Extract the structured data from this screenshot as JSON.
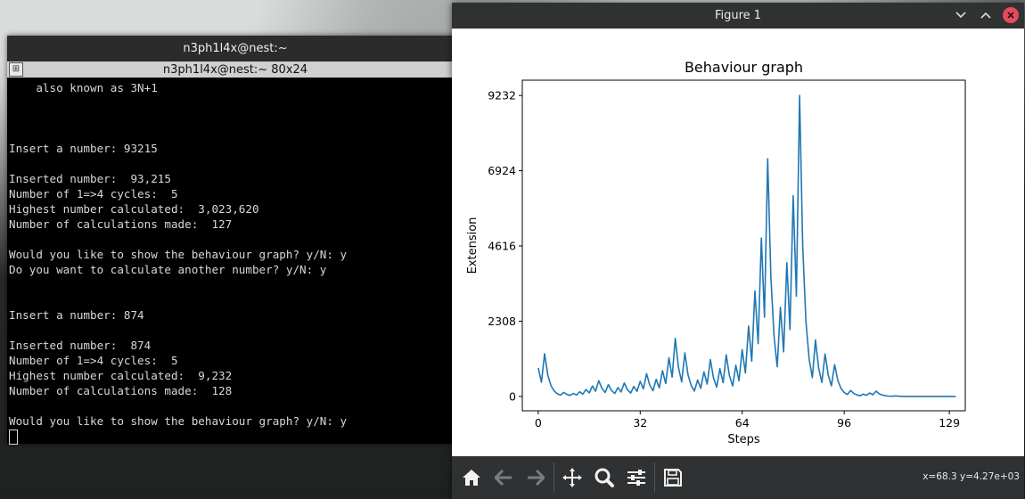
{
  "terminal": {
    "title": "n3ph1l4x@nest:~",
    "tab_title": "n3ph1l4x@nest:~ 80x24",
    "lines": [
      "    also known as 3N+1",
      "",
      "",
      "",
      "Insert a number: 93215",
      "",
      "Inserted number:  93,215",
      "Number of 1=>4 cycles:  5",
      "Highest number calculated:  3,023,620",
      "Number of calculations made:  127",
      "",
      "Would you like to show the behaviour graph? y/N: y",
      "Do you want to calculate another number? y/N: y",
      "",
      "",
      "Insert a number: 874",
      "",
      "Inserted number:  874",
      "Number of 1=>4 cycles:  5",
      "Highest number calculated:  9,232",
      "Number of calculations made:  128",
      "",
      "Would you like to show the behaviour graph? y/N: y"
    ]
  },
  "figure": {
    "title": "Figure 1",
    "coords": "x=68.3 y=4.27e+03",
    "toolbar": [
      "home-icon",
      "back-icon",
      "forward-icon",
      "pan-icon",
      "zoom-icon",
      "configure-icon",
      "save-icon"
    ],
    "colors": {
      "line": "#1f77b4",
      "window_bar": "#2f3133",
      "close_button": "#e64b5b"
    }
  },
  "chart_data": {
    "type": "line",
    "title": "Behaviour graph",
    "xlabel": "Steps",
    "ylabel": "Extension",
    "xlim": [
      -5,
      134
    ],
    "ylim": [
      -440,
      9700
    ],
    "xticks": [
      0,
      32,
      64,
      96,
      129
    ],
    "yticks": [
      0,
      2308,
      4616,
      6924,
      9232
    ],
    "grid": false,
    "series": [
      {
        "values": [
          874,
          437,
          1312,
          656,
          328,
          164,
          82,
          41,
          124,
          62,
          31,
          94,
          47,
          142,
          71,
          214,
          107,
          322,
          161,
          484,
          242,
          121,
          364,
          182,
          91,
          274,
          137,
          412,
          206,
          103,
          310,
          155,
          466,
          233,
          700,
          350,
          175,
          526,
          263,
          790,
          395,
          1186,
          593,
          1780,
          890,
          445,
          1336,
          668,
          334,
          167,
          502,
          251,
          754,
          377,
          1132,
          566,
          283,
          850,
          425,
          1276,
          638,
          319,
          958,
          479,
          1438,
          719,
          2158,
          1079,
          3238,
          1619,
          4858,
          2429,
          7288,
          3644,
          1822,
          911,
          2734,
          1367,
          4102,
          2051,
          6154,
          3077,
          9232,
          4616,
          2308,
          1154,
          577,
          1732,
          866,
          433,
          1300,
          650,
          325,
          976,
          488,
          244,
          122,
          61,
          184,
          92,
          46,
          23,
          70,
          35,
          106,
          53,
          160,
          80,
          40,
          20,
          10,
          5,
          16,
          8,
          4,
          2,
          1,
          4,
          2,
          1,
          4,
          2,
          1,
          4,
          2,
          1,
          4,
          2,
          1,
          4,
          2,
          1
        ]
      }
    ]
  }
}
